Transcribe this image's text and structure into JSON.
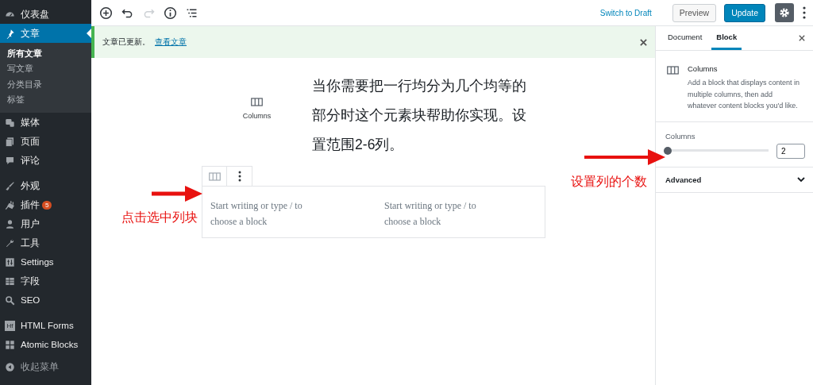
{
  "sidebar": {
    "groups": [
      [
        {
          "label": "仪表盘",
          "selected": false
        },
        {
          "label": "文章",
          "selected": true,
          "children": [
            {
              "label": "所有文章",
              "selected": true
            },
            {
              "label": "写文章",
              "selected": false
            },
            {
              "label": "分类目录",
              "selected": false
            },
            {
              "label": "标签",
              "selected": false
            }
          ]
        },
        {
          "label": "媒体",
          "selected": false
        },
        {
          "label": "页面",
          "selected": false
        },
        {
          "label": "评论",
          "selected": false
        }
      ],
      [
        {
          "label": "外观",
          "selected": false
        },
        {
          "label": "插件",
          "selected": false,
          "badge": "5"
        },
        {
          "label": "用户",
          "selected": false
        },
        {
          "label": "工具",
          "selected": false
        },
        {
          "label": "Settings",
          "selected": false
        },
        {
          "label": "字段",
          "selected": false
        },
        {
          "label": "SEO",
          "selected": false
        }
      ],
      [
        {
          "label": "HTML Forms",
          "selected": false,
          "logo": "Hf"
        },
        {
          "label": "Atomic Blocks",
          "selected": false
        }
      ]
    ],
    "collapse": "收起菜单"
  },
  "toolbar": {
    "tools": [
      {
        "kind": "add",
        "disabled": false
      },
      {
        "kind": "undo",
        "disabled": false
      },
      {
        "kind": "redo",
        "disabled": true
      },
      {
        "kind": "info",
        "disabled": false
      },
      {
        "kind": "outline",
        "disabled": false
      }
    ],
    "switch_to_draft": "Switch to Draft",
    "preview": "Preview",
    "update": "Update",
    "settings_pressed": true
  },
  "notice": {
    "text": "文章已更新。",
    "link": "查看文章"
  },
  "editor": {
    "inserter_label": "Columns",
    "paragraph": "当你需要把一行均分为几个均等的部分时这个元素块帮助你实现。设置范围2-6列。",
    "columns": [
      {
        "placeholder": "Start writing or type / to choose a block"
      },
      {
        "placeholder": "Start writing or type / to choose a block"
      }
    ]
  },
  "panel": {
    "tabs": [
      {
        "label": "Document",
        "selected": false
      },
      {
        "label": "Block",
        "selected": true
      }
    ],
    "block": {
      "title": "Columns",
      "description": "Add a block that displays content in multiple columns, then add whatever content blocks you'd like."
    },
    "columns_setting": {
      "label": "Columns",
      "level": 0,
      "value": "2"
    },
    "advanced": {
      "label": "Advanced",
      "expanded": false
    }
  },
  "annotations": [
    {
      "text": "点击选中列块"
    },
    {
      "text": "设置列的个数"
    }
  ]
}
